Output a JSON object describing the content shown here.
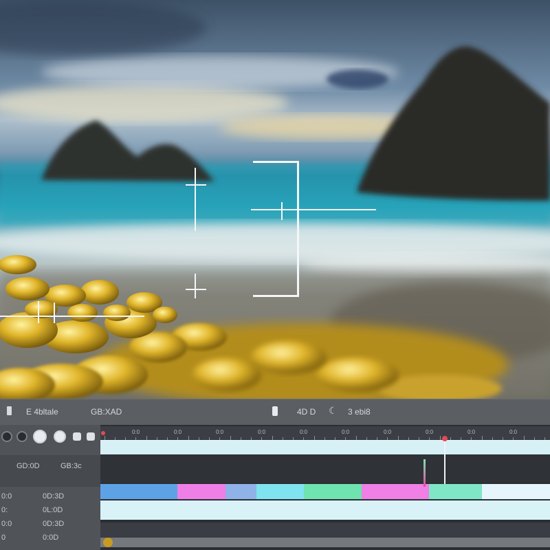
{
  "statusbar": {
    "left_icon": "page-icon",
    "left_text": "E 4bltale",
    "mid_text": "GB:XAD",
    "center_icon": "battery-icon",
    "center_text": "4D D",
    "right_icon": "moon-icon",
    "right_text": "3 ebi8"
  },
  "timeline": {
    "transport_icons": [
      "record-icon",
      "stop-icon",
      "play-icon",
      "pause-icon",
      "square-icon",
      "square-icon"
    ],
    "header_values": [
      "GD:0D",
      "GB:3c"
    ],
    "rows": [
      {
        "label": "0:0",
        "value": "0D:3D"
      },
      {
        "label": "0:",
        "value": "0L:0D"
      },
      {
        "label": "0:0",
        "value": "0D:3D"
      },
      {
        "label": "0",
        "value": "0:0D"
      }
    ],
    "ruler_labels": [
      "0:0",
      "0:0",
      "0:0",
      "0:0",
      "0:0",
      "0:0",
      "0:0",
      "0:0",
      "0:0",
      "0:0",
      "0:0"
    ],
    "clip_colors": [
      "#5ea2e6",
      "#ee7fe6",
      "#8fb2e8",
      "#7fe3f0",
      "#6fe3b0",
      "#f07fe6",
      "#7fe6c6",
      "#e6f4fb"
    ],
    "accent_color": "#e24a5a"
  }
}
